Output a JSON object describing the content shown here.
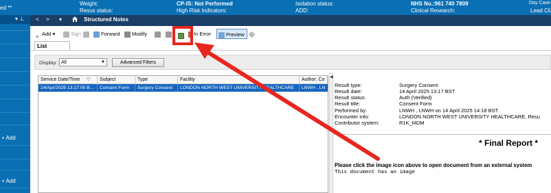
{
  "banner": {
    "left_fragment": "ed **",
    "weight_label": "Weight:",
    "resus_label": "Resus status:",
    "cpis": "CP-IS: Not Performed",
    "high_risk": "High Risk Indicators:",
    "isolation": "Isolation status:",
    "add": "ADD:",
    "nhs": "NHS No.:961 740 7809",
    "clinical_research": "Clinical Research:",
    "day_case": "Day Case",
    "lead_clin": "Lead Clin"
  },
  "sidebar": {
    "pin_glyph": "▾ ⊥",
    "add_label_1": "+ Add",
    "add_label_2": "+ Add"
  },
  "titlebar": {
    "back": "<",
    "forward": ">",
    "menu": "▾",
    "home_icon": "home-icon",
    "title": "Structured Notes"
  },
  "toolbar": {
    "add": "Add",
    "add_arrow": "▾",
    "sign": "Sign",
    "forward": "Forward",
    "modify": "Modify",
    "in_error": "In Error",
    "preview": "Preview"
  },
  "tabs": {
    "list": "List"
  },
  "filter": {
    "display_label": "Display :",
    "display_value": "All",
    "advanced_filters": "Advanced Filters"
  },
  "table": {
    "columns": [
      "Service Date/Time",
      "Subject",
      "Type",
      "Facility",
      "Author; Co"
    ],
    "sort_glyph": "▽",
    "rows": [
      [
        "14/Apr/2025 13:17:00 B...",
        "Consent Form",
        "Surgery Consent",
        "LONDON NORTH WEST UNIVERSITY HEALTHCARE",
        "LNWH , LN"
      ]
    ]
  },
  "preview": {
    "fields": [
      {
        "label": "Result type:",
        "value": "Surgery Consent"
      },
      {
        "label": "Result date:",
        "value": "14 April 2025 13:17 BST"
      },
      {
        "label": "Result status:",
        "value": "Auth (Verified)"
      },
      {
        "label": "Result title:",
        "value": "Consent Form"
      },
      {
        "label": "Performed by:",
        "value": "LNWH , LNWH on 14 April 2025 14:18 BST"
      },
      {
        "label": "Encounter info:",
        "value": "LONDON NORTH WEST UNIVERSITY HEALTHCARE, Resu"
      },
      {
        "label": "Contributor system:",
        "value": "R1K_MDM"
      }
    ],
    "final_report": "* Final Report *",
    "click_message": "Please click the image icon above to open document from an external system",
    "has_image": "This document has an image"
  },
  "colors": {
    "banner_blue": "#0a6fb3",
    "titlebar_navy": "#1a3e66",
    "selection_blue": "#1565c0",
    "annotation_red": "#e8261f"
  }
}
